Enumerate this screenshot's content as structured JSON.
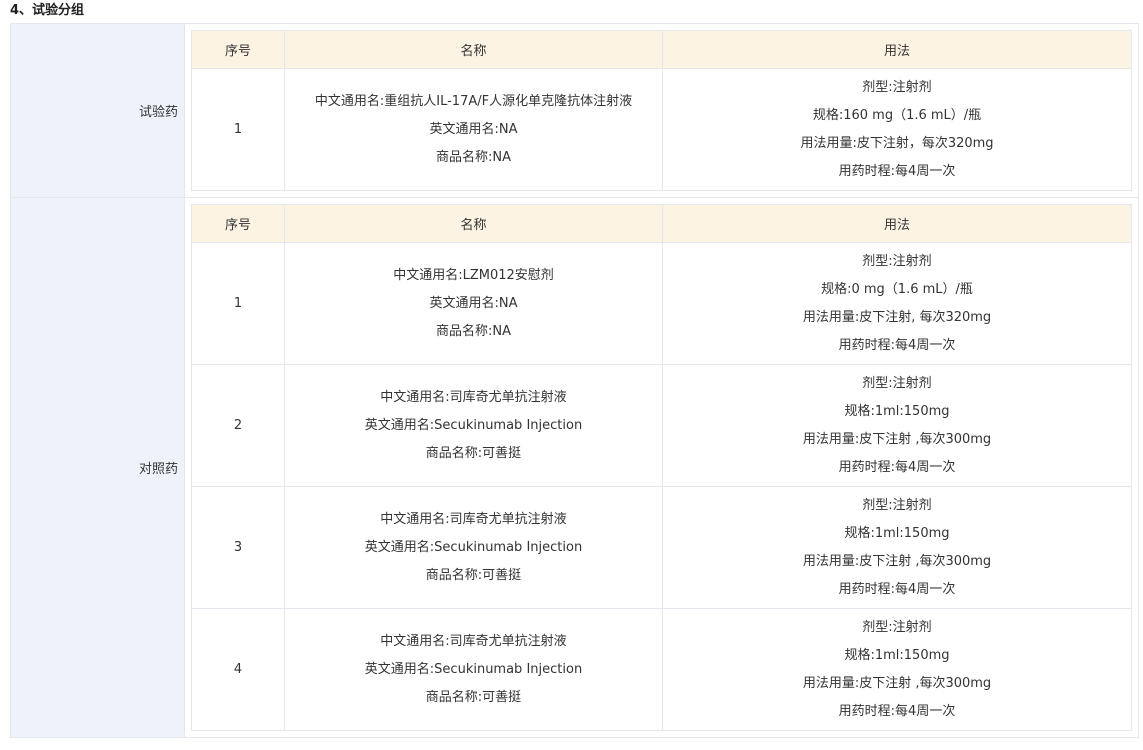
{
  "section_title": "4、试验分组",
  "table_headers": {
    "no": "序号",
    "name": "名称",
    "usage": "用法"
  },
  "groups": [
    {
      "label": "试验药",
      "rows": [
        {
          "no": "1",
          "name_lines": [
            "中文通用名:重组抗人IL-17A/F人源化单克隆抗体注射液",
            "英文通用名:NA",
            "商品名称:NA"
          ],
          "usage_lines": [
            "剂型:注射剂",
            "规格:160 mg（1.6 mL）/瓶",
            "用法用量:皮下注射，每次320mg",
            "用药时程:每4周一次"
          ]
        }
      ]
    },
    {
      "label": "对照药",
      "rows": [
        {
          "no": "1",
          "name_lines": [
            "中文通用名:LZM012安慰剂",
            "英文通用名:NA",
            "商品名称:NA"
          ],
          "usage_lines": [
            "剂型:注射剂",
            "规格:0 mg（1.6 mL）/瓶",
            "用法用量:皮下注射, 每次320mg",
            "用药时程:每4周一次"
          ]
        },
        {
          "no": "2",
          "name_lines": [
            "中文通用名:司库奇尤单抗注射液",
            "英文通用名:Secukinumab Injection",
            "商品名称:可善挺"
          ],
          "usage_lines": [
            "剂型:注射剂",
            "规格:1ml:150mg",
            "用法用量:皮下注射 ,每次300mg",
            "用药时程:每4周一次"
          ]
        },
        {
          "no": "3",
          "name_lines": [
            "中文通用名:司库奇尤单抗注射液",
            "英文通用名:Secukinumab Injection",
            "商品名称:可善挺"
          ],
          "usage_lines": [
            "剂型:注射剂",
            "规格:1ml:150mg",
            "用法用量:皮下注射 ,每次300mg",
            "用药时程:每4周一次"
          ]
        },
        {
          "no": "4",
          "name_lines": [
            "中文通用名:司库奇尤单抗注射液",
            "英文通用名:Secukinumab Injection",
            "商品名称:可善挺"
          ],
          "usage_lines": [
            "剂型:注射剂",
            "规格:1ml:150mg",
            "用法用量:皮下注射 ,每次300mg",
            "用药时程:每4周一次"
          ]
        }
      ]
    }
  ]
}
